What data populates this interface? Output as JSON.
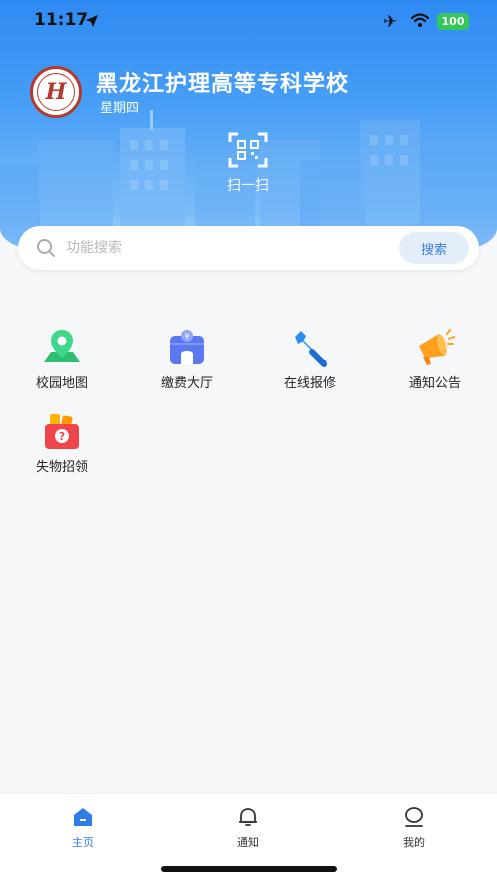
{
  "status_bar": {
    "time": "11:17",
    "battery": "100"
  },
  "header": {
    "school_name": "黑龙江护理高等专科学校",
    "weekday": "星期四",
    "logo_letter": "H",
    "scan_label": "扫一扫"
  },
  "search": {
    "placeholder": "功能搜索",
    "button_label": "搜索"
  },
  "functions": [
    {
      "label": "校园地图",
      "icon": "map-icon"
    },
    {
      "label": "缴费大厅",
      "icon": "payment-hall-icon"
    },
    {
      "label": "在线报修",
      "icon": "wrench-icon"
    },
    {
      "label": "通知公告",
      "icon": "megaphone-icon"
    },
    {
      "label": "失物招领",
      "icon": "lost-found-bag-icon"
    }
  ],
  "tabbar": {
    "tabs": [
      {
        "label": "主页",
        "icon": "home-icon",
        "active": true
      },
      {
        "label": "通知",
        "icon": "bell-icon",
        "active": false
      },
      {
        "label": "我的",
        "icon": "profile-icon",
        "active": false
      }
    ]
  },
  "colors": {
    "header_blue": "#2f8af3",
    "accent": "#2f7ee8",
    "battery_green": "#34c759",
    "logo_red": "#b33a2d"
  }
}
